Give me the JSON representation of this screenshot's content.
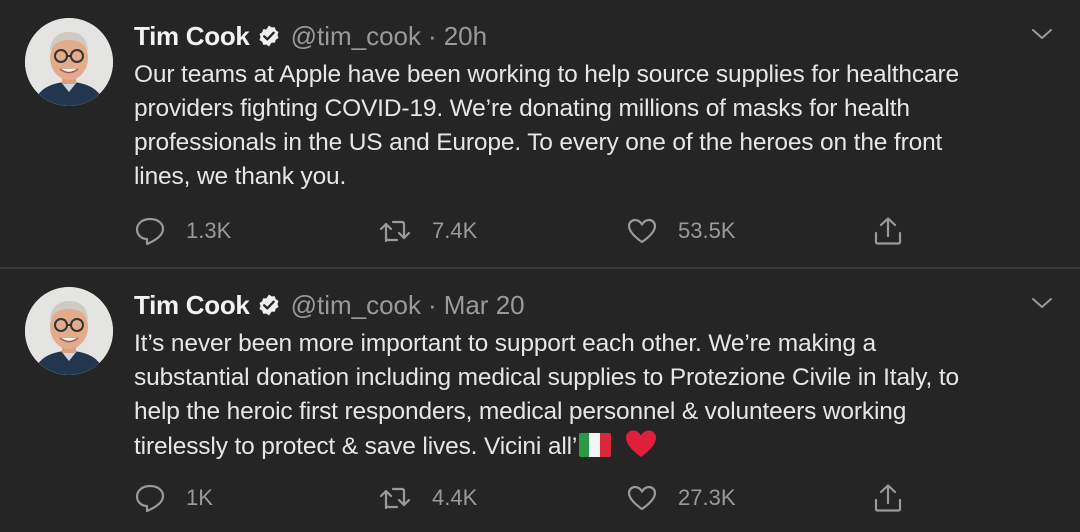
{
  "tweets": [
    {
      "author": {
        "name": "Tim Cook",
        "handle": "@tim_cook",
        "verified": true
      },
      "separator": "·",
      "time": "20h",
      "lines": [
        "Our teams at Apple have been working to help source supplies for healthcare",
        "providers fighting COVID-19. We’re donating millions of masks for health",
        "professionals in the US and Europe. To every one of the heroes on the front",
        "lines, we thank you."
      ],
      "stats": {
        "replies": "1.3K",
        "retweets": "7.4K",
        "likes": "53.5K"
      }
    },
    {
      "author": {
        "name": "Tim Cook",
        "handle": "@tim_cook",
        "verified": true
      },
      "separator": "·",
      "time": "Mar 20",
      "lines": [
        "It’s never been more important to support each other.  We’re making a",
        "substantial donation including medical supplies to Protezione Civile in Italy, to",
        "help the heroic first responders, medical personnel & volunteers working",
        "tirelessly to protect & save lives. Vicini all’"
      ],
      "emoji": [
        "italy-flag",
        "red-heart"
      ],
      "stats": {
        "replies": "1K",
        "retweets": "4.4K",
        "likes": "27.3K"
      }
    }
  ],
  "colors": {
    "background": "#252525",
    "text": "#e6e6e6",
    "secondary": "#9a9a9a",
    "divider": "#3a3a3a",
    "heart": "#e0203a"
  }
}
